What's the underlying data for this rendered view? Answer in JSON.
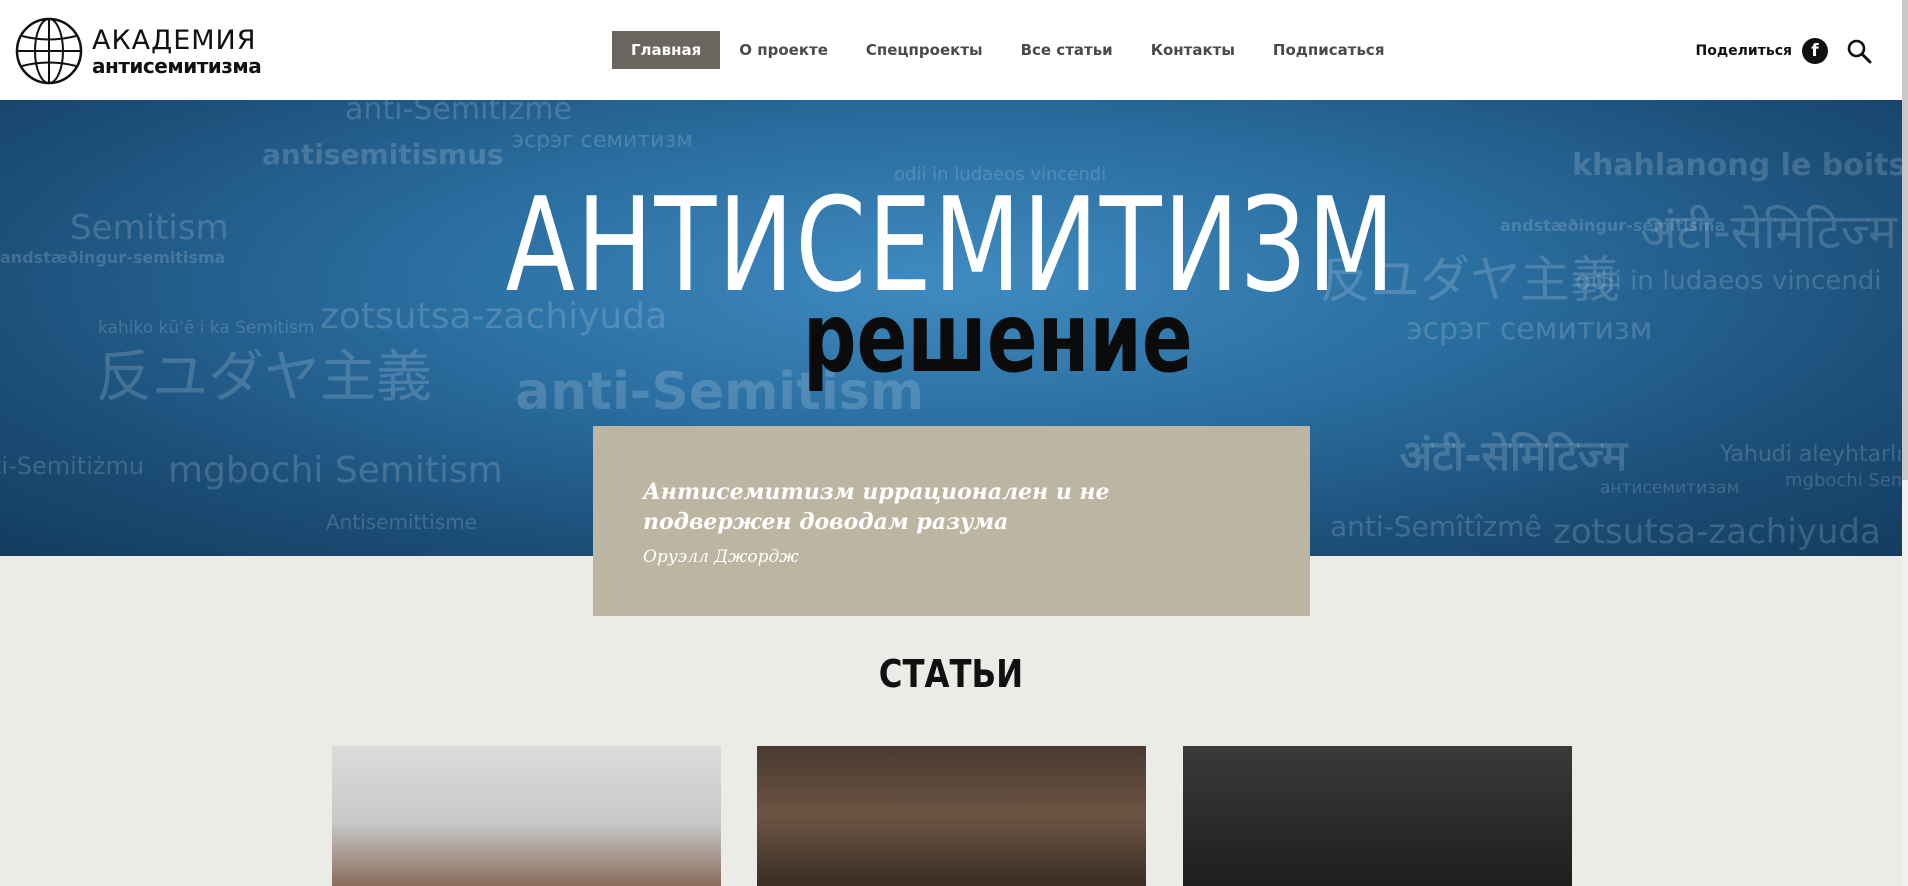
{
  "logo": {
    "line1": "АКАДЕМИЯ",
    "line2": "антисемитизма"
  },
  "nav": [
    {
      "label": "Главная",
      "active": true
    },
    {
      "label": "О проекте"
    },
    {
      "label": "Спецпроекты"
    },
    {
      "label": "Все статьи"
    },
    {
      "label": "Контакты"
    },
    {
      "label": "Подписаться"
    }
  ],
  "share": {
    "label": "Поделиться",
    "icon": "facebook-icon"
  },
  "search": {
    "icon": "search-icon"
  },
  "hero": {
    "title": "АНТИСЕМИТИЗМ",
    "subtitle": "решение",
    "watermark_words": [
      "anti-Semitizme",
      "antisemitismus",
      "эсрэг семитизм",
      "khahlanong le boits'oaro",
      "odii in ludaeos vincendi",
      "Semitism",
      "andstæðingur-semitisma",
      "zotsutsa-zachiyuda",
      "kahiko kū'ē i ka Semitism",
      "anti-Semitism",
      "mgbochi Semitism",
      "ti-Semitiżmu",
      "Antisemittisme",
      "Yahudi aleyhtarlığı",
      "антисемитизам",
      "mgbochi Semi",
      "anti-Semîtîzmê",
      "反ユダヤ主義",
      "अंटी-सेमिटिज्म"
    ]
  },
  "quote": {
    "text": "Антисемитизм иррационален и не подвержен доводам разума",
    "author": "Оруэлл Джордж"
  },
  "articles": {
    "title": "СТАТЬИ"
  },
  "colors": {
    "header_bg": "#ffffff",
    "nav_active_bg": "#6a665f",
    "hero_blue": "#2a6d9f",
    "quote_bg": "#bcb5a2",
    "page_bg": "#ebebe7"
  }
}
